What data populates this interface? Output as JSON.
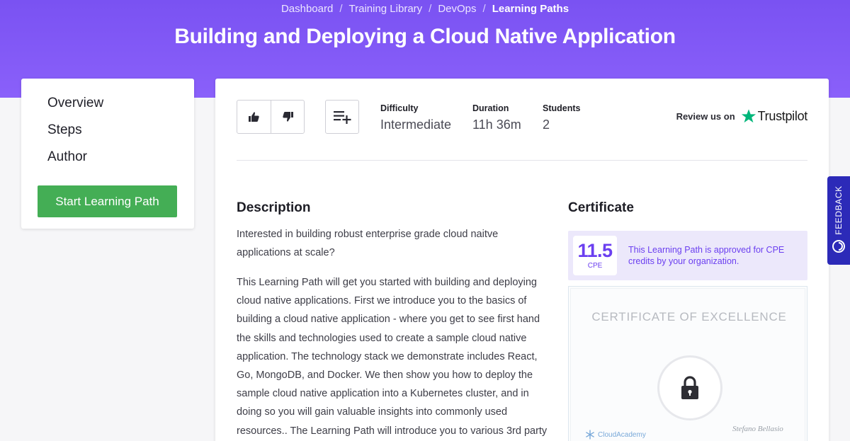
{
  "breadcrumb": {
    "items": [
      "Dashboard",
      "Training Library",
      "DevOps",
      "Learning Paths"
    ],
    "separator": "/"
  },
  "page": {
    "title": "Building and Deploying a Cloud Native Application"
  },
  "sidebar": {
    "nav": [
      "Overview",
      "Steps",
      "Author"
    ],
    "start_button": "Start Learning Path"
  },
  "stats": {
    "difficulty": {
      "label": "Difficulty",
      "value": "Intermediate"
    },
    "duration": {
      "label": "Duration",
      "value": "11h 36m"
    },
    "students": {
      "label": "Students",
      "value": "2"
    }
  },
  "actions": {
    "thumbs_up_icon": "thumbs-up-icon",
    "thumbs_down_icon": "thumbs-down-icon",
    "add_to_playlist_icon": "playlist-add-icon"
  },
  "trustpilot": {
    "review_text": "Review us on",
    "brand": "Trustpilot",
    "star_color": "#00b67a"
  },
  "description": {
    "heading": "Description",
    "p1": "Interested in building robust enterprise grade cloud naitve applications at scale?",
    "p2": "This Learning Path will get you started with building and deploying cloud native applications. First we introduce you to the basics of building a cloud native application - where you get to see first hand the skills and technologies used to create a sample cloud native application. The technology stack we demonstrate includes React, Go, MongoDB, and Docker. We then show you how to deploy the sample cloud native application into a Kubernetes cluster, and in doing so you will gain valuable insights into commonly used resources.. The Learning Path will introduce you to various 3rd party"
  },
  "certificate": {
    "heading": "Certificate",
    "cpe_value": "11.5",
    "cpe_unit": "CPE",
    "cpe_text": "This Learning Path is approved for CPE credits by your organization.",
    "preview_title": "CERTIFICATE OF EXCELLENCE",
    "brand": "CloudAcademy",
    "signature": "Stefano Bellasio"
  },
  "feedback": {
    "label": "FEEDBACK"
  },
  "colors": {
    "hero": "#7a52f2",
    "accent": "#6b3ff0",
    "start_button": "#44ae55",
    "feedback_tab": "#2c2ab8"
  }
}
